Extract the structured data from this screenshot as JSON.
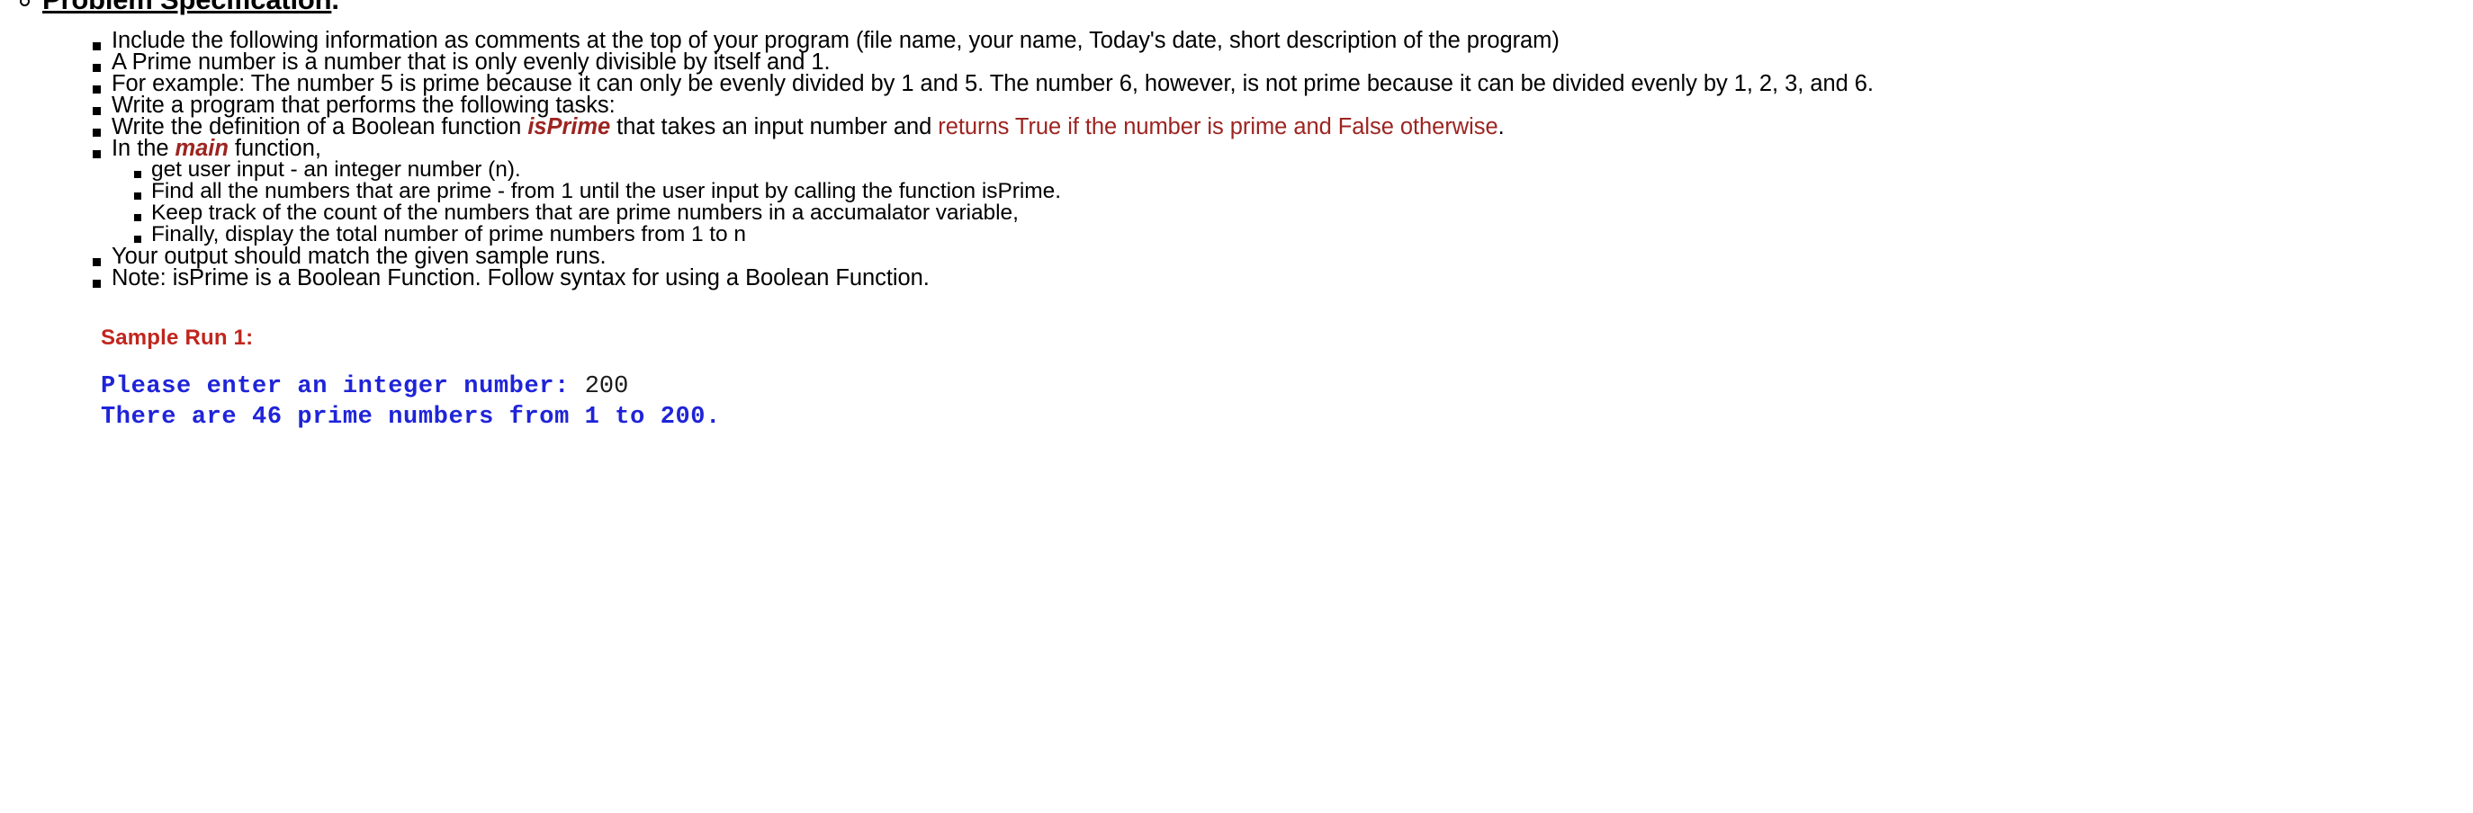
{
  "document": {
    "heading": {
      "bullet_icon": "hollow-circle-bullet",
      "underlined_text": "Problem Specification",
      "trailing_punctuation": "."
    },
    "bullets": [
      {
        "id": "include-comments",
        "text": "Include the following information as comments at the top of your program (file name, your name, Today's date, short description of the program)"
      },
      {
        "id": "prime-definition",
        "text": "A Prime number is a number that is only evenly divisible by itself and 1."
      },
      {
        "id": "prime-example",
        "text": "For example: The number 5 is prime because it can only be evenly divided by 1 and 5. The number 6, however, is not prime because it can be divided evenly by 1, 2, 3, and 6."
      },
      {
        "id": "write-program",
        "text": "Write a program that performs the following tasks:"
      },
      {
        "id": "write-isprime-definition",
        "prefix": "Write the definition of a Boolean function ",
        "emphasis": "isPrime",
        "middle": " that takes an input number and ",
        "highlight": "returns True if the number is prime and False otherwise",
        "suffix": "."
      },
      {
        "id": "in-main-function",
        "prefix": "In the ",
        "emphasis": "main",
        "suffix": " function,"
      },
      {
        "id": "output-match",
        "text": "Your output should match the given sample runs."
      },
      {
        "id": "note-boolean",
        "text": "Note: isPrime is a Boolean Function. Follow syntax for using a Boolean Function."
      }
    ],
    "sub_bullets": [
      {
        "id": "get-user-input",
        "text": "get user input - an integer number (n)."
      },
      {
        "id": "find-primes",
        "text": "Find all the numbers that are prime - from 1 until the user input by calling the function isPrime."
      },
      {
        "id": "keep-count",
        "text": "Keep track of the count of the numbers that are prime numbers in a accumalator variable,"
      },
      {
        "id": "display-total",
        "text": "Finally, display the total number of prime numbers from 1 to n"
      }
    ],
    "sample_run": {
      "label": "Sample Run 1:",
      "console": {
        "line1_prompt": "Please enter an integer number: ",
        "line1_input": "200",
        "line2": "There are 46 prime numbers from 1 to 200."
      }
    },
    "colors": {
      "emphasis_maroon": "#9c2420",
      "sample_run_red": "#c1251d",
      "console_blue": "#1f24d8",
      "body_black": "#000000",
      "page_background": "#ffffff"
    }
  }
}
